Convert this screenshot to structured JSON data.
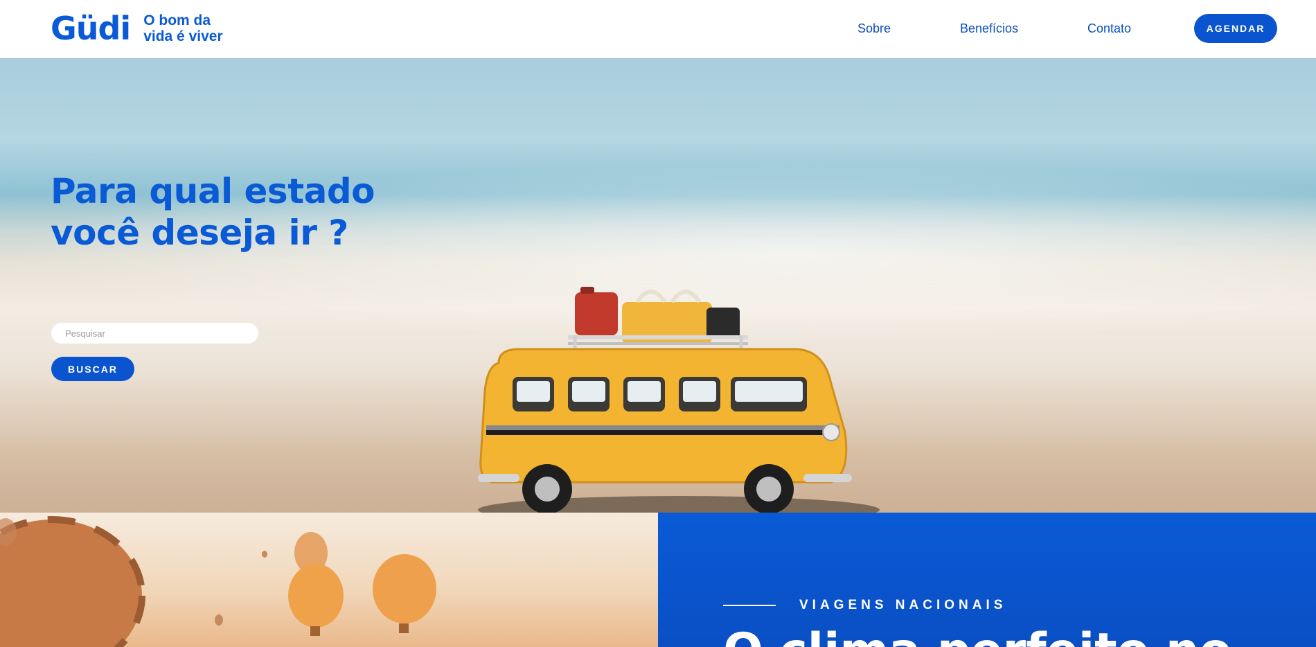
{
  "header": {
    "logo": "Güdi",
    "tagline_line1": "O bom da",
    "tagline_line2": "vida é viver",
    "nav": [
      {
        "label": "Sobre"
      },
      {
        "label": "Benefícios"
      },
      {
        "label": "Contato"
      }
    ],
    "cta_label": "AGENDAR"
  },
  "hero": {
    "title_line1": "Para qual estado",
    "title_line2": "você deseja ir ?",
    "search_placeholder": "Pesquisar",
    "search_value": "",
    "search_button": "BUSCAR"
  },
  "section": {
    "eyebrow": "VIAGENS NACIONAIS",
    "heading": "O clima perfeito no"
  },
  "colors": {
    "brand_blue": "#0a5ad6",
    "white": "#ffffff"
  }
}
